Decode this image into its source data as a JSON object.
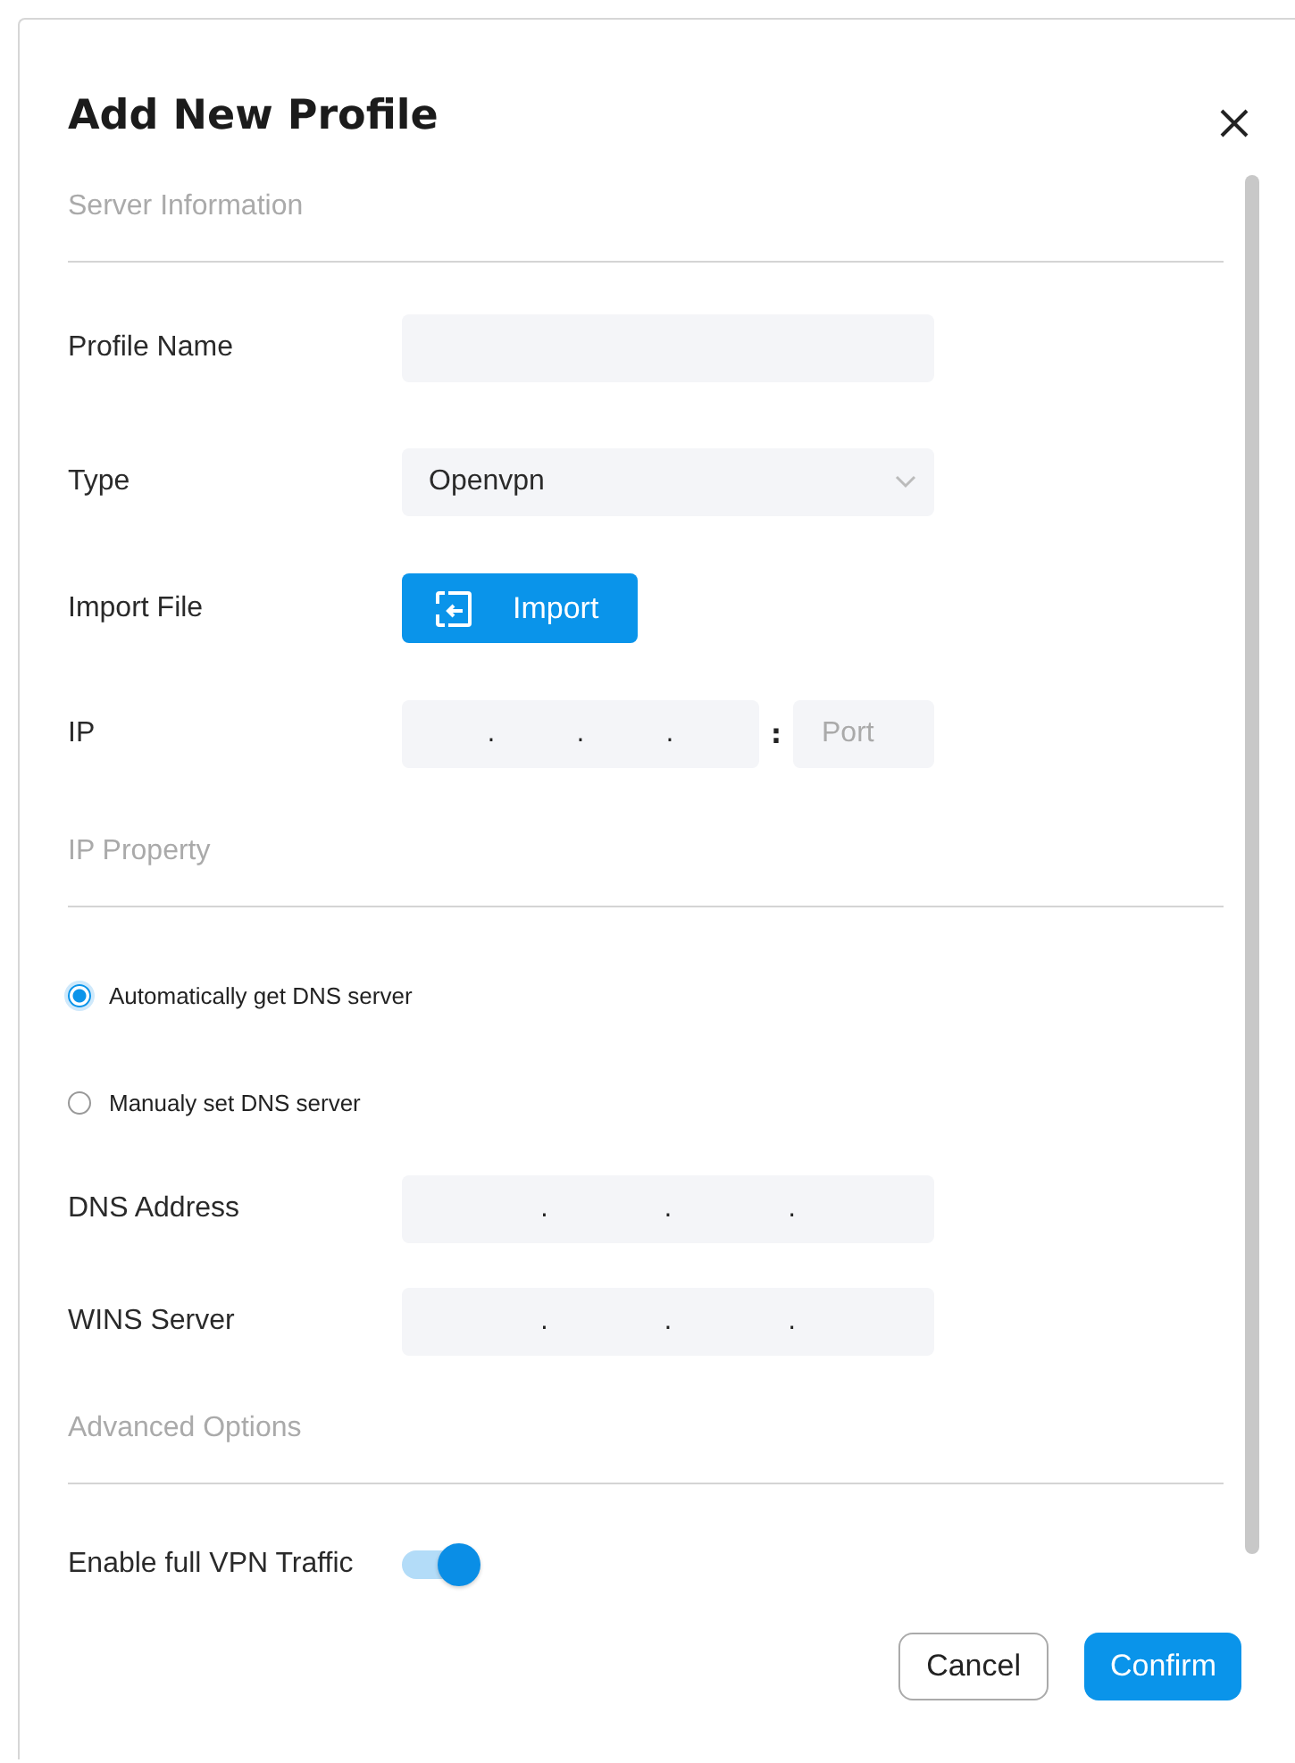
{
  "dialog": {
    "title": "Add New Profile"
  },
  "sections": [
    {
      "kind": "server",
      "heading": "Server Information",
      "profile_name": {
        "label": "Profile Name"
      },
      "type": {
        "label": "Type",
        "value": "Openvpn"
      },
      "import_file": {
        "label": "Import File",
        "button": "Import"
      },
      "ip": {
        "label": "IP",
        "separators": [
          ".",
          ".",
          "."
        ],
        "port_separator": ":",
        "port_placeholder": "Port"
      }
    },
    {
      "kind": "ip_property",
      "heading": "IP Property",
      "dns_modes": [
        {
          "label": "Automatically get DNS server",
          "selected": true
        },
        {
          "label": "Manualy set DNS server",
          "selected": false
        }
      ],
      "dns_address": {
        "label": "DNS Address",
        "separators": [
          ".",
          ".",
          "."
        ]
      },
      "wins_server": {
        "label": "WINS Server",
        "separators": [
          ".",
          ".",
          "."
        ]
      }
    },
    {
      "kind": "advanced",
      "heading": "Advanced Options",
      "full_vpn_traffic": {
        "label": "Enable full VPN Traffic",
        "on": true
      }
    }
  ],
  "buttons": [
    {
      "kind": "secondary",
      "label": "Cancel"
    },
    {
      "kind": "primary",
      "label": "Confirm"
    }
  ]
}
